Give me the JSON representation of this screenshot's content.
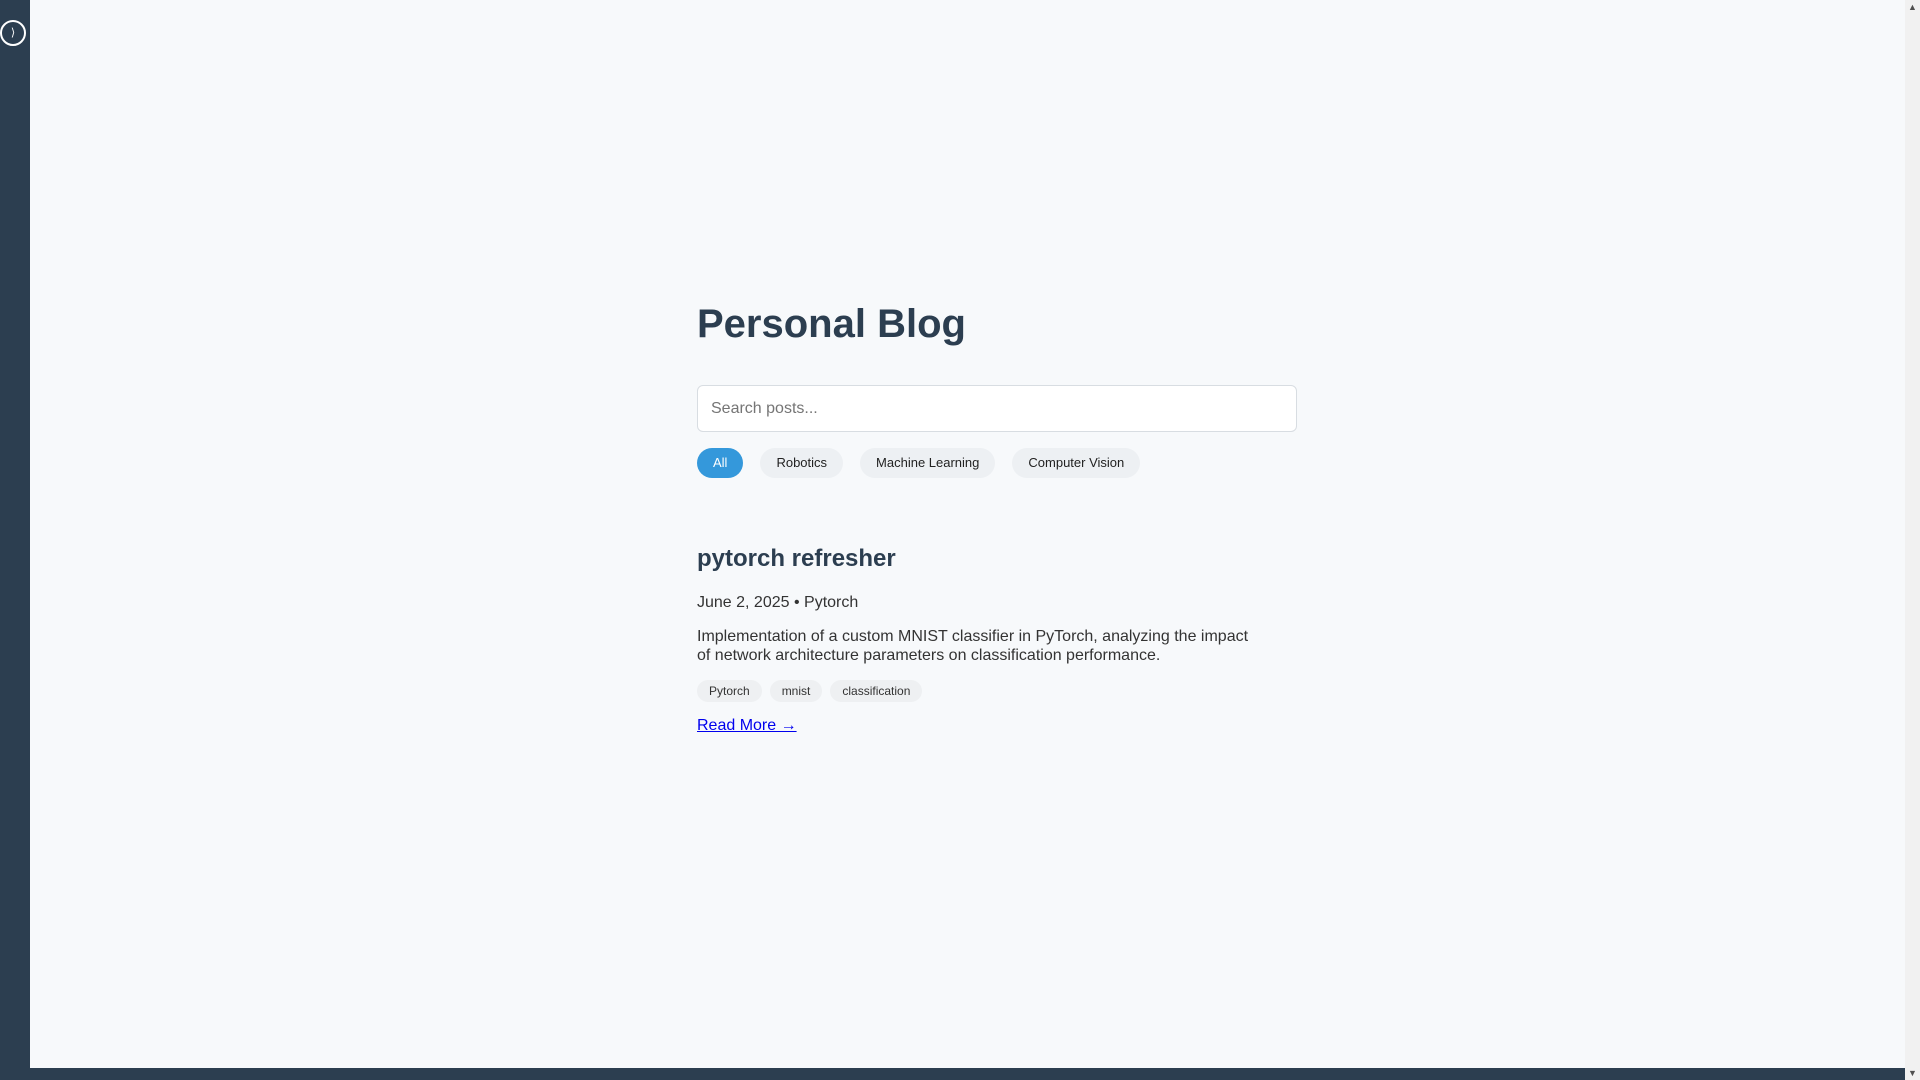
{
  "sidebar": {
    "toggle_glyph": "⟩"
  },
  "header": {
    "title": "Personal Blog"
  },
  "search": {
    "placeholder": "Search posts...",
    "value": ""
  },
  "filters": {
    "active": "All",
    "items": [
      "All",
      "Robotics",
      "Machine Learning",
      "Computer Vision"
    ]
  },
  "posts": [
    {
      "title": "pytorch refresher",
      "date": "June 2, 2025",
      "category": "Pytorch",
      "meta": "June 2, 2025 • Pytorch",
      "excerpt": "Implementation of a custom MNIST classifier in PyTorch, analyzing the impact of network architecture parameters on classification performance.",
      "tags": [
        "Pytorch",
        "mnist",
        "classification"
      ],
      "read_more": "Read More →"
    }
  ],
  "colors": {
    "sidebar": "#2c3e50",
    "background": "#f7f9fb",
    "accent": "#3498db",
    "heading": "#2c3e50",
    "link": "#0000ee"
  },
  "icons": {
    "sidebar_toggle": "sidebar-toggle-icon",
    "scroll_up": "scroll-up-arrow-icon",
    "scroll_down": "scroll-down-arrow-icon"
  }
}
